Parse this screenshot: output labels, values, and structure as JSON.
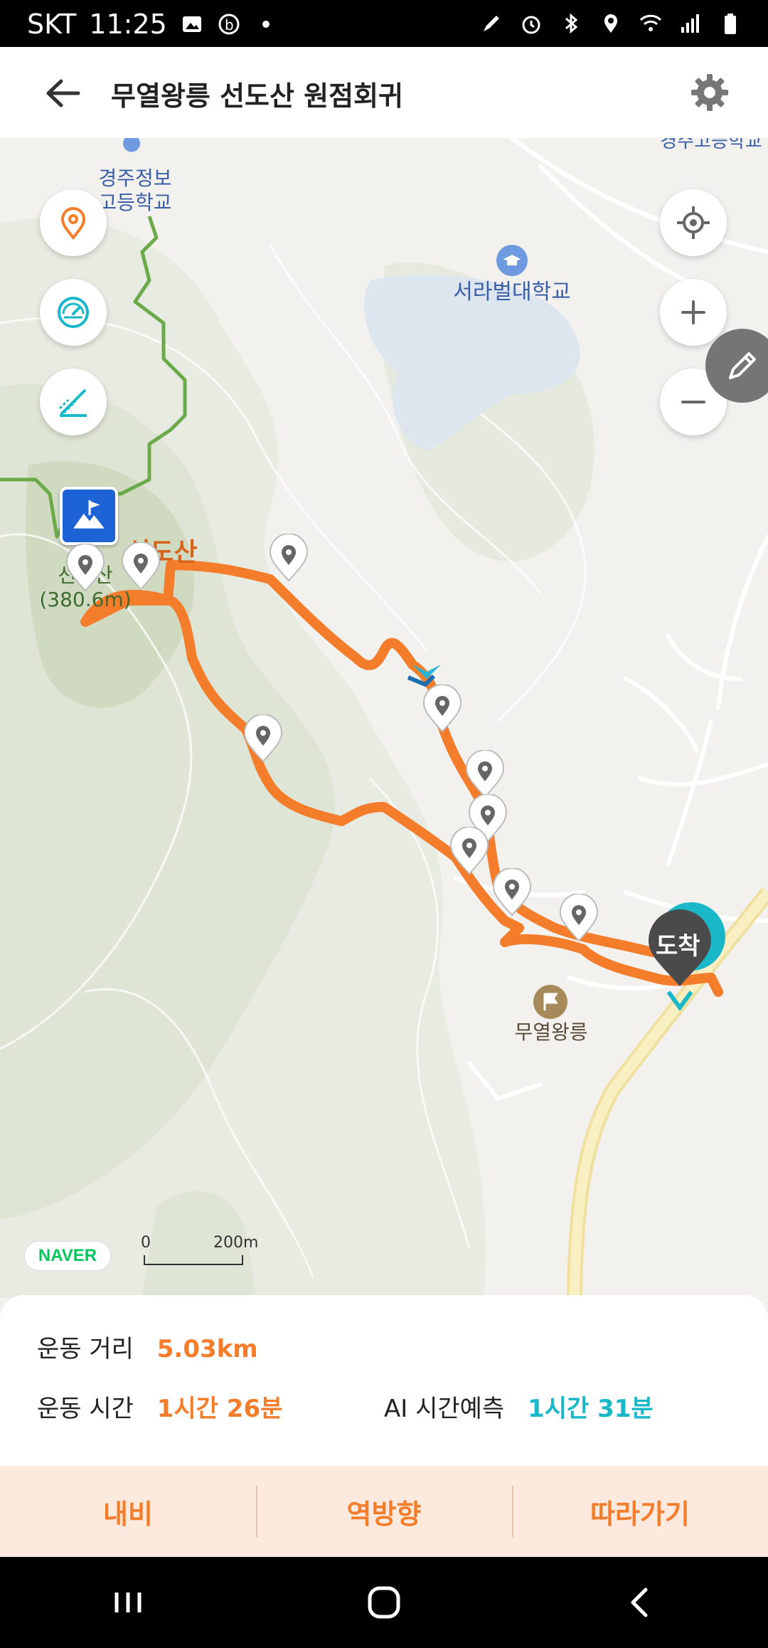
{
  "status": {
    "carrier": "SKT",
    "time": "11:25"
  },
  "header": {
    "title": "무열왕릉 선도산 원점회귀"
  },
  "map": {
    "labels": {
      "school1": "경주정보\n고등학교",
      "university": "서라벌대학교",
      "peak": "선도산",
      "peak_alt": "선도산\n(380.6m)",
      "tomb": "무열왕릉",
      "school_top": "경주고등학교",
      "arrival": "도착"
    },
    "scale": {
      "zero": "0",
      "distance": "200m"
    },
    "attribution": "NAVER"
  },
  "stats": {
    "distance_label": "운동 거리",
    "distance_value": "5.03km",
    "time_label": "운동 시간",
    "time_value": "1시간 26분",
    "ai_label": "AI 시간예측",
    "ai_value": "1시간 31분"
  },
  "actions": {
    "navi": "내비",
    "reverse": "역방향",
    "follow": "따라가기"
  },
  "colors": {
    "route": "#f47d2c",
    "accent_teal": "#19b7c7",
    "trail_green": "#6ba94a",
    "start_blue": "#1e63d6"
  }
}
